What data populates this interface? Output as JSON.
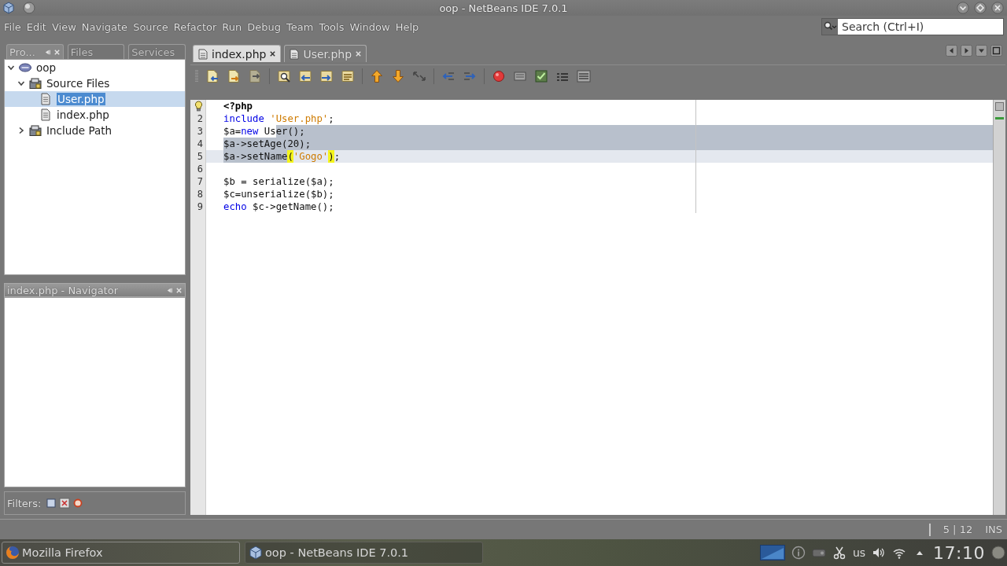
{
  "window": {
    "title": "oop - NetBeans IDE 7.0.1"
  },
  "menu": [
    "File",
    "Edit",
    "View",
    "Navigate",
    "Source",
    "Refactor",
    "Run",
    "Debug",
    "Team",
    "Tools",
    "Window",
    "Help"
  ],
  "search": {
    "placeholder": "Search (Ctrl+I)"
  },
  "left_tabs": [
    {
      "label": "Pro...",
      "selected": true
    },
    {
      "label": "Files",
      "selected": false
    },
    {
      "label": "Services",
      "selected": false
    }
  ],
  "project_tree": [
    {
      "label": "oop",
      "kind": "project",
      "expanded": true,
      "selected": false,
      "children": [
        {
          "label": "Source Files",
          "kind": "folder",
          "expanded": true,
          "selected": false,
          "children": [
            {
              "label": "User.php",
              "kind": "file",
              "selected": true
            },
            {
              "label": "index.php",
              "kind": "file",
              "selected": false
            }
          ]
        },
        {
          "label": "Include Path",
          "kind": "folder",
          "expanded": false,
          "selected": false
        }
      ]
    }
  ],
  "navigator": {
    "title": "index.php - Navigator",
    "filters_label": "Filters:"
  },
  "editor_tabs": [
    {
      "label": "index.php",
      "selected": true
    },
    {
      "label": "User.php",
      "selected": false
    }
  ],
  "toolbar": [
    {
      "kind": "doc-back",
      "disabled": false
    },
    {
      "kind": "doc-arrow",
      "disabled": false
    },
    {
      "kind": "doc-forward",
      "disabled": true
    },
    {
      "kind": "separator"
    },
    {
      "kind": "find",
      "disabled": false
    },
    {
      "kind": "find-up",
      "disabled": false
    },
    {
      "kind": "find-down",
      "disabled": false
    },
    {
      "kind": "highlight",
      "disabled": false
    },
    {
      "kind": "separator"
    },
    {
      "kind": "bookmark-up",
      "disabled": false
    },
    {
      "kind": "bookmark-down",
      "disabled": false
    },
    {
      "kind": "bookmark-toggle",
      "disabled": false
    },
    {
      "kind": "separator"
    },
    {
      "kind": "shift-left",
      "disabled": false
    },
    {
      "kind": "shift-right",
      "disabled": false
    },
    {
      "kind": "separator"
    },
    {
      "kind": "record",
      "disabled": false
    },
    {
      "kind": "stop",
      "disabled": true
    },
    {
      "kind": "check",
      "disabled": false
    },
    {
      "kind": "comment",
      "disabled": false
    },
    {
      "kind": "uncomment",
      "disabled": true
    }
  ],
  "code_lines": [
    {
      "hint": true,
      "selected": false,
      "current": false,
      "tokens": [
        {
          "text": "<?php",
          "kind": "tag"
        }
      ]
    },
    {
      "number": "2",
      "hint": false,
      "selected": false,
      "current": false,
      "tokens": [
        {
          "text": "include ",
          "kind": "keyword"
        },
        {
          "text": "'User.php'",
          "kind": "string"
        },
        {
          "text": ";",
          "kind": "plain"
        }
      ]
    },
    {
      "number": "3",
      "hint": false,
      "selected": true,
      "current": false,
      "tokens": [
        {
          "text": "$a=",
          "kind": "plain"
        },
        {
          "text": "new",
          "kind": "keyword"
        },
        {
          "text": " Us",
          "kind": "plain"
        },
        {
          "text": "er();",
          "kind": "selection"
        }
      ]
    },
    {
      "number": "4",
      "hint": false,
      "selected": true,
      "current": false,
      "tokens": [
        {
          "text": "$a->setAge(20);",
          "kind": "selection"
        }
      ]
    },
    {
      "number": "5",
      "hint": false,
      "selected": false,
      "current": true,
      "tokens": [
        {
          "text": "$a->setName",
          "kind": "selection"
        },
        {
          "text": "(",
          "kind": "bracket-match"
        },
        {
          "text": "'Gogo'",
          "kind": "string"
        },
        {
          "text": ")",
          "kind": "bracket-match"
        },
        {
          "text": ";",
          "kind": "plain"
        }
      ]
    },
    {
      "number": "6",
      "hint": false,
      "selected": false,
      "current": false
    },
    {
      "number": "7",
      "hint": false,
      "selected": false,
      "current": false,
      "tokens": [
        {
          "text": "$b = serialize($a);",
          "kind": "plain"
        }
      ]
    },
    {
      "number": "8",
      "hint": false,
      "selected": false,
      "current": false,
      "tokens": [
        {
          "text": "$c=unserialize($b);",
          "kind": "plain"
        }
      ]
    },
    {
      "number": "9",
      "hint": false,
      "selected": false,
      "current": false,
      "tokens": [
        {
          "text": "echo",
          "kind": "keyword"
        },
        {
          "text": " $c->getName();",
          "kind": "plain"
        }
      ]
    }
  ],
  "status_bar": {
    "caret_position": "5 | 12",
    "insert_mode": "INS"
  },
  "taskbar": {
    "tasks": [
      {
        "label": "Mozilla Firefox",
        "kind": "browser",
        "selected": false
      },
      {
        "label": "oop - NetBeans IDE 7.0.1",
        "kind": "ide",
        "selected": true
      }
    ],
    "keyboard_layout": "us",
    "clock": "17:10"
  }
}
